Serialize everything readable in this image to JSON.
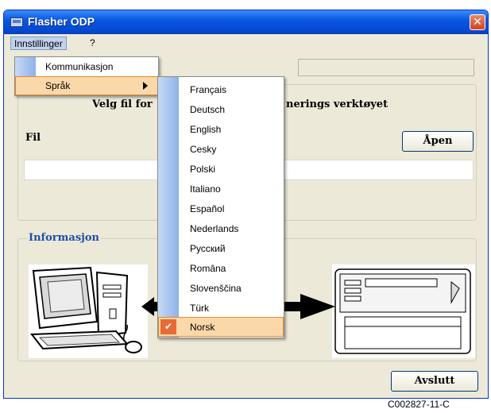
{
  "window": {
    "title": "Flasher ODP",
    "close_glyph": "✕"
  },
  "menubar": {
    "items": [
      {
        "label": "Innstillinger"
      },
      {
        "label": "?"
      }
    ]
  },
  "settings_menu": {
    "items": [
      {
        "label": "Kommunikasjon"
      },
      {
        "label": "Språk"
      }
    ]
  },
  "language_menu": {
    "items": [
      {
        "label": "Français"
      },
      {
        "label": "Deutsch"
      },
      {
        "label": "English"
      },
      {
        "label": "Cesky"
      },
      {
        "label": "Polski"
      },
      {
        "label": "Italiano"
      },
      {
        "label": "Español"
      },
      {
        "label": "Nederlands"
      },
      {
        "label": "Русский"
      },
      {
        "label": "Româna"
      },
      {
        "label": "Slovenščina"
      },
      {
        "label": "Türk"
      },
      {
        "label": "Norsk",
        "selected": true,
        "check": "✔"
      }
    ]
  },
  "main": {
    "heading_left": "Velg fil for",
    "heading_right": "nerings verktøyet",
    "file_label": "Fil",
    "open_button": "Åpen",
    "file_value": ""
  },
  "info": {
    "title": "Informasjon"
  },
  "footer": {
    "exit_button": "Avslutt"
  },
  "caption": "C002827-11-C",
  "colors": {
    "titlebar": "#0a58e0",
    "highlight": "#fbd8a9",
    "accent_orange": "#e86a35",
    "info_blue": "#1f4fa8"
  }
}
